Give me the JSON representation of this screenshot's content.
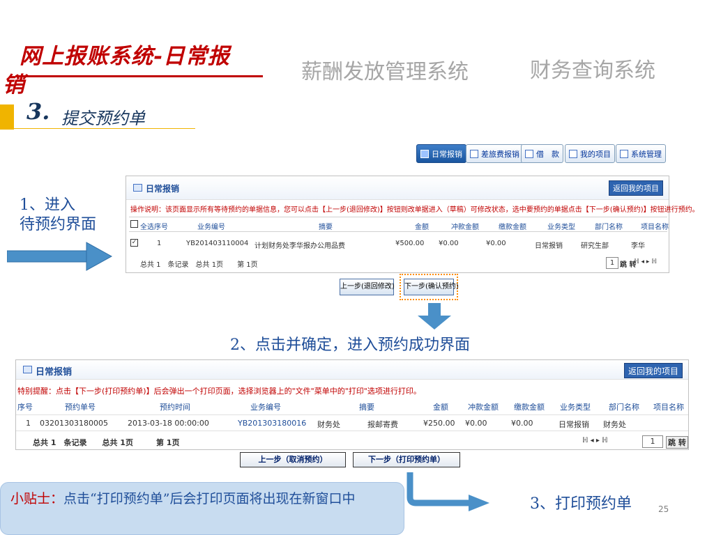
{
  "header": {
    "title_line1": "网上报账系统-日常报",
    "title_line2": "销",
    "salary_system": "薪酬发放管理系统",
    "finance_system": "财务查询系统",
    "step_number": "3.",
    "step_title": "提交预约单"
  },
  "nav_tabs": [
    {
      "label": "日常报销",
      "icon": "receipt-icon",
      "active": true
    },
    {
      "label": "差旅费报销",
      "icon": "travel-icon",
      "active": false
    },
    {
      "label": "借　款",
      "icon": "loan-icon",
      "active": false
    },
    {
      "label": "我的项目",
      "icon": "project-icon",
      "active": false
    },
    {
      "label": "系统管理",
      "icon": "settings-icon",
      "active": false
    }
  ],
  "upper_panel": {
    "title": "日常报销",
    "return_button": "返回我的项目",
    "note": "操作说明：该页面显示所有等待预约的单据信息，您可以点击【上一步(退回修改)】按钮则改单据进入（草稿）可修改状态，选中要预约的单据点击【下一步(确认预约)】按钮进行预约。",
    "columns": [
      "全选",
      "序号",
      "业务编号",
      "摘要",
      "金额",
      "冲款金额",
      "缴款金额",
      "业务类型",
      "部门名称",
      "项目名称"
    ],
    "row": {
      "checked": "✓",
      "index": "1",
      "business_no": "YB201403110004",
      "summary": "计划财务处李华报办公用品费",
      "amount": "¥500.00",
      "offset": "¥0.00",
      "payment": "¥0.00",
      "type": "日常报销",
      "dept": "研究生部",
      "project": "李华"
    },
    "footer_left": "总共 1　条记录　总共  1页　　第 1页",
    "page_value": "1",
    "jump_label": "跳 转",
    "pager": "ℍ ◂ ▸ ℍ",
    "prev_button": "上一步(退回修改)",
    "next_button": "下一步(确认预约)"
  },
  "left_instruction": "1、进入\n待预约界面",
  "mid_caption": "2、点击并确定，进入预约成功界面",
  "lower_panel": {
    "title": "日常报销",
    "return_button": "返回我的项目",
    "note": "特别提醒：点击【下一步(打印预约单)】后会弹出一个打印页面，选择浏览器上的\"文件\"菜单中的\"打印\"选项进行打印。",
    "columns": [
      "序号",
      "预约单号",
      "预约时间",
      "业务编号",
      "摘要",
      "金额",
      "冲款金额",
      "缴款金额",
      "业务类型",
      "部门名称",
      "项目名称"
    ],
    "row": {
      "index": "1",
      "reservation_no": "03201303180005",
      "time": "2013-03-18 00:00:00",
      "business_no": "YB201303180016",
      "dept_short": "财务处",
      "summary": "报邮寄费",
      "amount": "¥250.00",
      "offset": "¥0.00",
      "payment": "¥0.00",
      "type": "日常报销",
      "dept": "财务处",
      "project": ""
    },
    "footer_left": "总共 1　条记录　　总共  1页　　　第  1页",
    "pager": "ℍ ◂ ▸ ℍ",
    "page_value": "1",
    "jump_label": "跳 转",
    "prev_button": "上一步（取消预约）",
    "next_button": "下一步（打印预约单）"
  },
  "tip": {
    "label": "小贴士：",
    "text": "点击“打印预约单”后会打印页面将出现在新窗口中"
  },
  "step3_caption": "3、打印预约单",
  "page_number": "25",
  "colors": {
    "title_red": "#c00000",
    "caption_blue": "#1f4e99",
    "gray_title": "#a6a6a6",
    "accent_yellow": "#f0b400",
    "arrow_blue": "#4a90c8"
  }
}
